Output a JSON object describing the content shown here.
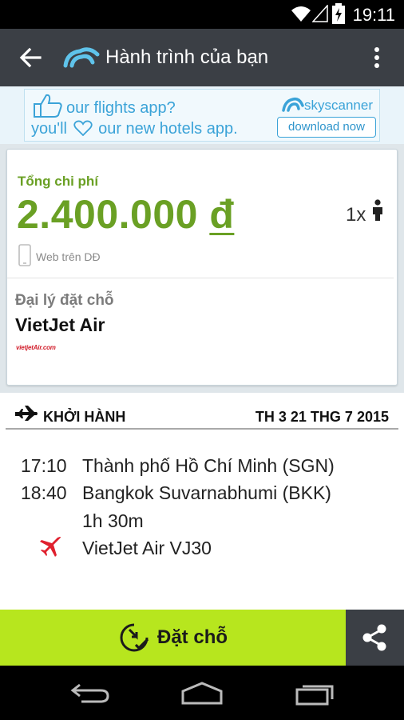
{
  "status_bar": {
    "time": "19:11"
  },
  "app_bar": {
    "title": "Hành trình của bạn"
  },
  "ad": {
    "line1": "our flights app?",
    "line2_prefix": "you'll",
    "line2_suffix": "our new hotels app.",
    "brand": "skyscanner",
    "download_label": "download now"
  },
  "price_card": {
    "cost_label": "Tổng chi phí",
    "amount": "2.400.000",
    "currency": "đ",
    "passenger_count": "1x",
    "channel_label": "Web trên DĐ",
    "agent_label": "Đại lý đặt chỗ",
    "agent_name": "VietJet Air",
    "agent_logo_text": "vietjetAir.com"
  },
  "departure": {
    "header_label": "KHỞI HÀNH",
    "date": "TH 3 21 THG 7 2015",
    "depart_time": "17:10",
    "depart_place": "Thành phố Hồ Chí Minh (SGN)",
    "arrive_time": "18:40",
    "arrive_place": "Bangkok Suvarnabhumi (BKK)",
    "duration": "1h 30m",
    "flight": "VietJet Air VJ30"
  },
  "actions": {
    "book_label": "Đặt chỗ"
  },
  "colors": {
    "accent_green": "#6aa024",
    "book_button": "#b7e61e",
    "app_bar": "#3b3f45",
    "brand_blue": "#3ba3d8",
    "airline_red": "#d21f2c"
  }
}
